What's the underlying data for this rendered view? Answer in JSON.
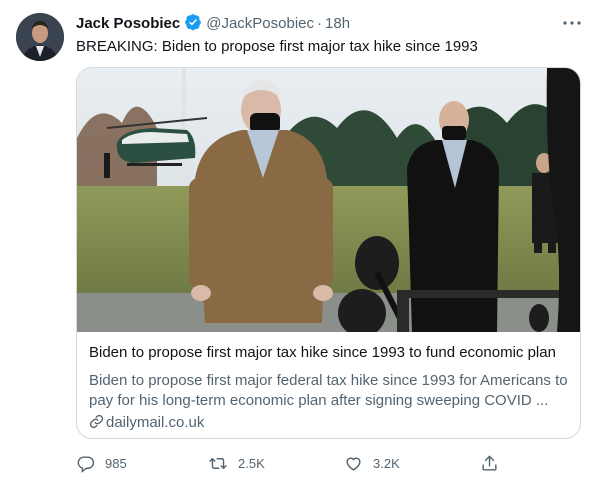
{
  "tweet": {
    "author_name": "Jack Posobiec",
    "handle": "@JackPosobiec",
    "separator": "·",
    "time": "18h",
    "text": "BREAKING: Biden to propose first major tax hike since 1993",
    "icons": {
      "verified": "verified-badge-icon",
      "more": "more-options-icon",
      "avatar": "avatar"
    }
  },
  "card": {
    "title": "Biden to propose first major tax hike since 1993 to fund economic plan",
    "description_line1": "Biden to propose first major federal tax hike since 1993 for Americans to",
    "description_line2": "pay for his long-term economic plan after signing sweeping COVID ...",
    "domain": "dailymail.co.uk"
  },
  "actions": {
    "replies": "985",
    "retweets": "2.5K",
    "likes": "3.2K",
    "icons": [
      "reply-icon",
      "retweet-icon",
      "like-icon",
      "share-icon"
    ]
  },
  "colors": {
    "text": "#0f1419",
    "secondary": "#536471",
    "border": "#cfd9de",
    "verified": "#1d9bf0"
  }
}
